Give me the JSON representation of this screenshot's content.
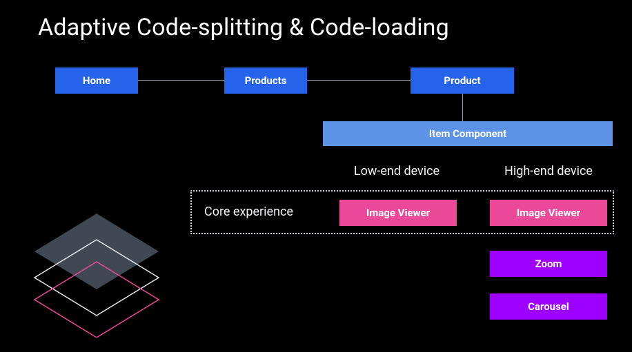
{
  "title": "Adaptive Code-splitting & Code-loading",
  "routes": {
    "home": "Home",
    "products": "Products",
    "product": "Product"
  },
  "itemComponent": "Item Component",
  "columns": {
    "low": "Low-end device",
    "high": "High-end device"
  },
  "rows": {
    "core": "Core experience"
  },
  "modules": {
    "imageViewer": "Image Viewer",
    "zoom": "Zoom",
    "carousel": "Carousel"
  }
}
